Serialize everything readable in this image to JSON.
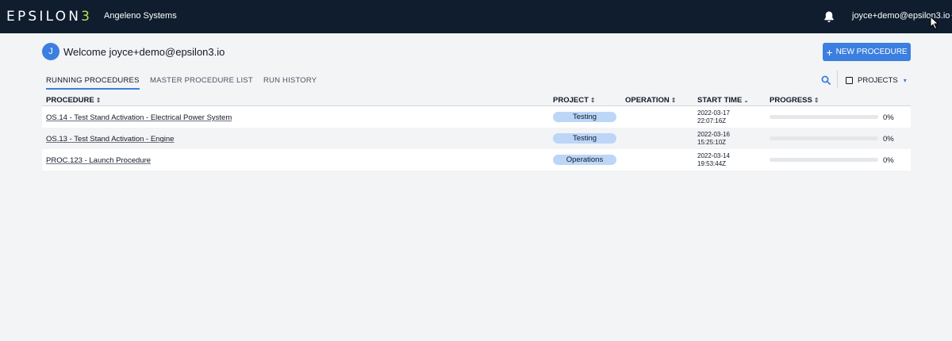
{
  "header": {
    "logo_main": "EPSILON",
    "logo_accent": "3",
    "org_name": "Angeleno Systems",
    "user_email": "joyce+demo@epsilon3.io",
    "user_caret": "▾"
  },
  "welcome": {
    "avatar_initial": "J",
    "text": "Welcome joyce+demo@epsilon3.io"
  },
  "new_procedure_button": {
    "icon": "+",
    "label": "NEW PROCEDURE"
  },
  "tabs": [
    {
      "label": "RUNNING PROCEDURES",
      "active": true
    },
    {
      "label": "MASTER PROCEDURE LIST",
      "active": false
    },
    {
      "label": "RUN HISTORY",
      "active": false
    }
  ],
  "filters": {
    "projects_label": "PROJECTS",
    "projects_caret": "▾"
  },
  "table": {
    "columns": [
      {
        "label": "PROCEDURE",
        "sort": "⇕"
      },
      {
        "label": "PROJECT",
        "sort": "⇕"
      },
      {
        "label": "OPERATION",
        "sort": "⇕"
      },
      {
        "label": "START TIME",
        "sort": "⌄"
      },
      {
        "label": "PROGRESS",
        "sort": "⇕"
      }
    ],
    "rows": [
      {
        "procedure": "OS.14 - Test Stand Activation - Electrical Power System",
        "project": "Testing",
        "operation": "",
        "date": "2022-03-17",
        "time": "22:07:16Z",
        "progress": 0,
        "progress_label": "0%"
      },
      {
        "procedure": "OS.13 - Test Stand Activation - Engine",
        "project": "Testing",
        "operation": "",
        "date": "2022-03-16",
        "time": "15:25:10Z",
        "progress": 0,
        "progress_label": "0%"
      },
      {
        "procedure": "PROC.123 - Launch Procedure",
        "project": "Operations",
        "operation": "",
        "date": "2022-03-14",
        "time": "19:53:44Z",
        "progress": 0,
        "progress_label": "0%"
      }
    ]
  },
  "icons": {
    "bell": "bell-icon",
    "search": "search-icon",
    "cursor": "mouse-pointer-icon"
  },
  "colors": {
    "topbar": "#0f1d2e",
    "accent": "#3b7fe0",
    "logo_accent": "#b6e04a",
    "pill": "#bcd6f7"
  }
}
